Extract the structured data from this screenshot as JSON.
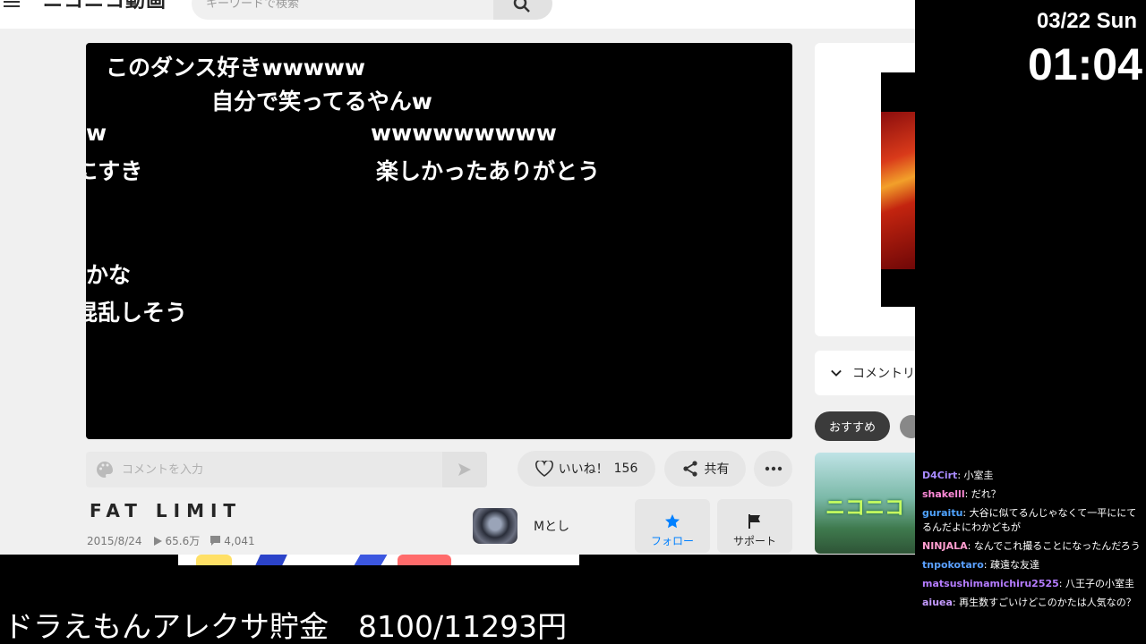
{
  "site": {
    "logo": "ニコニコ動画",
    "search_placeholder": "キーワードで検索"
  },
  "player": {
    "comments": [
      "このダンス好きwwwww",
      "自分で笑ってるやんw",
      "w",
      "wwwwwwwww",
      "にすき",
      "楽しかったありがとう",
      "かな",
      "混乱しそう"
    ]
  },
  "comment_form": {
    "placeholder": "コメントを入力"
  },
  "actions": {
    "like_label": "いいね！",
    "like_count": "156",
    "share_label": "共有"
  },
  "video": {
    "title": "FAT LIMIT",
    "date": "2015/8/24",
    "views": "65.6万",
    "comments": "4,041"
  },
  "owner": {
    "name": "Mとし",
    "follow_label": "フォロー",
    "support_label": "サポート"
  },
  "sidebar": {
    "comment_list_label": "コメントリスト",
    "tab_recommend": "おすすめ",
    "rec_thumb_text": "ニコニコ"
  },
  "overlay": {
    "date": "03/22 Sun",
    "time": "01:04",
    "goal_text": "ドラえもんアレクサ貯金　8100/11293円"
  },
  "chat": [
    {
      "user": "D4Cirt",
      "user_color": "#a98bff",
      "text": "小室圭"
    },
    {
      "user": "shakelll",
      "user_color": "#ff8ad8",
      "text": "だれ？"
    },
    {
      "user": "guraitu",
      "user_color": "#4fa3ff",
      "text": "大谷に似てるんじゃなくて一平ににてるんだよにわかどもが"
    },
    {
      "user": "NINJALA",
      "user_color": "#ff9ed0",
      "text": "なんでこれ撮ることになったんだろう"
    },
    {
      "user": "tnpokotaro",
      "user_color": "#5aa0ff",
      "text": "疎遠な友達"
    },
    {
      "user": "matsushimamichiru2525",
      "user_color": "#b57cff",
      "text": "八王子の小室圭"
    },
    {
      "user": "aiuea",
      "user_color": "#c59bff",
      "text": "再生数すごいけどこのかたは人気なの？"
    }
  ]
}
